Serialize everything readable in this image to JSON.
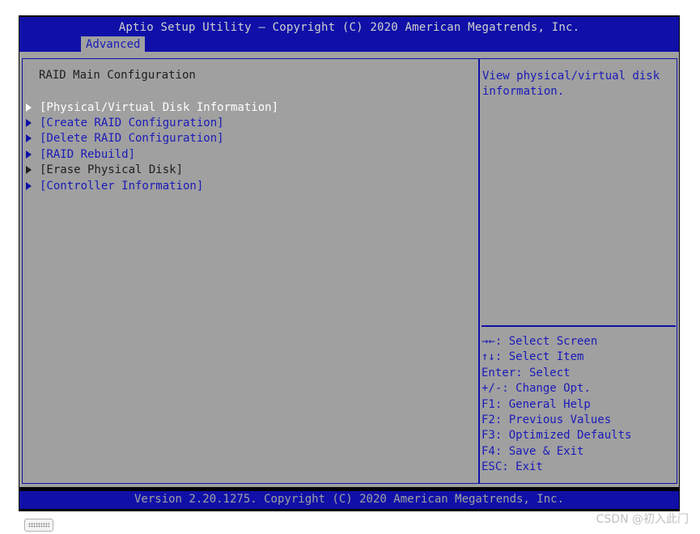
{
  "header": {
    "title": "Aptio Setup Utility – Copyright (C) 2020 American Megatrends, Inc.",
    "active_tab": "Advanced"
  },
  "main": {
    "heading": "RAID Main Configuration",
    "items": [
      {
        "label": "[Physical/Virtual Disk Information]",
        "state": "selected"
      },
      {
        "label": "[Create RAID Configuration]",
        "state": "normal"
      },
      {
        "label": "[Delete RAID Configuration]",
        "state": "normal"
      },
      {
        "label": "[RAID Rebuild]",
        "state": "normal"
      },
      {
        "label": "[Erase Physical Disk]",
        "state": "inactive"
      },
      {
        "label": "[Controller Information]",
        "state": "normal"
      }
    ]
  },
  "help": {
    "description": "View physical/virtual disk information.",
    "keys": [
      "→←: Select Screen",
      "↑↓: Select Item",
      "Enter: Select",
      "+/-: Change Opt.",
      "F1: General Help",
      "F2: Previous Values",
      "F3: Optimized Defaults",
      "F4: Save & Exit",
      "ESC: Exit"
    ]
  },
  "footer": {
    "version": "Version 2.20.1275. Copyright (C) 2020 American Megatrends, Inc."
  },
  "watermark": "CSDN @初入此门",
  "colors": {
    "bios_blue": "#1010a8",
    "panel_gray": "#a0a0a0",
    "selected_text": "#ffffff"
  },
  "icons": {
    "item_arrow": "triangle-right-icon",
    "keyboard": "keyboard-icon"
  }
}
